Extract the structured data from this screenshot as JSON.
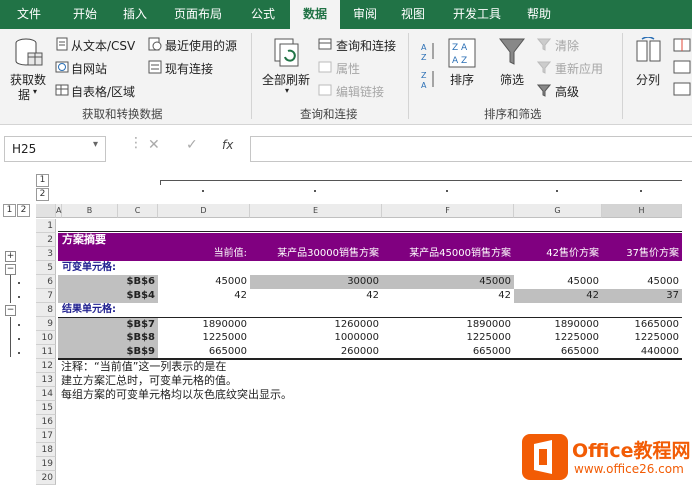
{
  "ribbon_tabs": [
    "文件",
    "开始",
    "插入",
    "页面布局",
    "公式",
    "数据",
    "审阅",
    "视图",
    "开发工具",
    "帮助"
  ],
  "active_tab": "数据",
  "groups": {
    "get": {
      "big_button": [
        "获取数",
        "据"
      ],
      "items": [
        "从文本/CSV",
        "自网站",
        "自表格/区域"
      ],
      "recent": "最近使用的源",
      "existing": "现有连接",
      "label": "获取和转换数据"
    },
    "query": {
      "refresh": "全部刷新",
      "items": [
        "查询和连接",
        "属性",
        "编辑链接"
      ],
      "label": "查询和连接"
    },
    "sort": {
      "sort": "排序",
      "filter": "筛选",
      "clear": "清除",
      "reapply": "重新应用",
      "advanced": "高级",
      "label": "排序和筛选"
    },
    "tools": {
      "split": "分列"
    }
  },
  "formula_bar": {
    "name_box": "H25",
    "fx": "fx"
  },
  "outline": {
    "col_levels": [
      "1",
      "2"
    ],
    "row_levels": [
      "1",
      "2"
    ]
  },
  "columns": [
    "A",
    "B",
    "C",
    "D",
    "E",
    "F",
    "G",
    "H"
  ],
  "rows": [
    "1",
    "2",
    "3",
    "5",
    "6",
    "7",
    "8",
    "9",
    "10",
    "11",
    "12",
    "13",
    "14",
    "15",
    "16",
    "17",
    "18",
    "19",
    "20"
  ],
  "summary": {
    "title": "方案摘要",
    "headers": [
      "当前值:",
      "某产品30000销售方案",
      "某产品45000销售方案",
      "42售价方案",
      "37售价方案"
    ],
    "changing_label": "可变单元格:",
    "changing": [
      {
        "ref": "$B$6",
        "values": [
          "45000",
          "30000",
          "45000",
          "45000",
          "45000"
        ]
      },
      {
        "ref": "$B$4",
        "values": [
          "42",
          "42",
          "42",
          "42",
          "37"
        ]
      }
    ],
    "result_label": "结果单元格:",
    "results": [
      {
        "ref": "$B$7",
        "values": [
          "1890000",
          "1260000",
          "1890000",
          "1890000",
          "1665000"
        ]
      },
      {
        "ref": "$B$8",
        "values": [
          "1225000",
          "1000000",
          "1225000",
          "1225000",
          "1225000"
        ]
      },
      {
        "ref": "$B$9",
        "values": [
          "665000",
          "260000",
          "665000",
          "665000",
          "440000"
        ]
      }
    ],
    "notes": [
      "注释：“当前值”这一列表示的是在",
      "建立方案汇总时，可变单元格的值。",
      "每组方案的可变单元格均以灰色底纹突出显示。"
    ]
  },
  "watermark": {
    "brand": "Office教程网",
    "url": "www.office26.com"
  },
  "colors": {
    "accent": "#217346",
    "purple": "#800080",
    "gray": "#bfbfbf",
    "logo_orange": "#f25c05"
  }
}
